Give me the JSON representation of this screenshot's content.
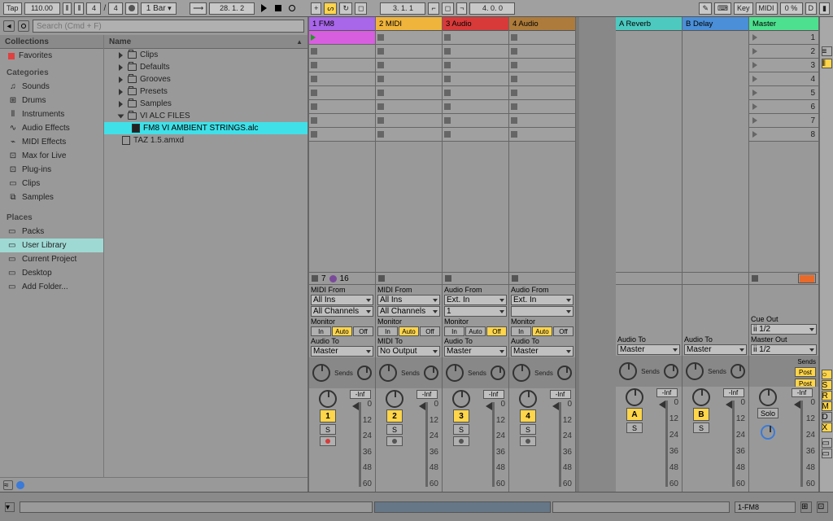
{
  "transport": {
    "tap": "Tap",
    "tempo": "110.00",
    "sig_num": "4",
    "sig_den": "4",
    "quantize": "1 Bar",
    "position": "28.  1.  2",
    "arrangement_pos": " 3.  1.  1",
    "loop_len": " 4.  0.  0",
    "key": "Key",
    "midi": "MIDI",
    "cpu": "0 %",
    "disk": "D"
  },
  "browser": {
    "search_placeholder": "Search (Cmd + F)",
    "collections_title": "Collections",
    "favorites": "Favorites",
    "categories_title": "Categories",
    "categories": [
      "Sounds",
      "Drums",
      "Instruments",
      "Audio Effects",
      "MIDI Effects",
      "Max for Live",
      "Plug-ins",
      "Clips",
      "Samples"
    ],
    "places_title": "Places",
    "places": [
      "Packs",
      "User Library",
      "Current Project",
      "Desktop",
      "Add Folder..."
    ],
    "name_header": "Name",
    "folders": [
      "Clips",
      "Defaults",
      "Grooves",
      "Presets",
      "Samples",
      "VI ALC FILES"
    ],
    "selected_file": "FM8 VI AMBIENT STRINGS.alc",
    "other_file": "TAZ 1.5.amxd"
  },
  "tracks": [
    {
      "name": "1 FM8",
      "cls": "fm8",
      "io_from": "MIDI From",
      "in1": "All Ins",
      "in2": "All Channels",
      "monitor": "Auto",
      "to_label": "Audio To",
      "out": "Master",
      "num": "1",
      "armed": true,
      "midi_count": "7",
      "midi_total": "16",
      "has_channel": true
    },
    {
      "name": "2 MIDI",
      "cls": "midi",
      "io_from": "MIDI From",
      "in1": "All Ins",
      "in2": "All Channels",
      "monitor": "Auto",
      "to_label": "MIDI To",
      "out": "No Output",
      "num": "2",
      "armed": false,
      "has_channel": true
    },
    {
      "name": "3 Audio",
      "cls": "audio3",
      "io_from": "Audio From",
      "in1": "Ext. In",
      "in2": "1",
      "monitor": "Off",
      "to_label": "Audio To",
      "out": "Master",
      "num": "3",
      "armed": false,
      "has_channel": true
    },
    {
      "name": "4 Audio",
      "cls": "audio4",
      "io_from": "Audio From",
      "in1": "Ext. In",
      "in2": "",
      "monitor": "Auto",
      "to_label": "Audio To",
      "out": "Master",
      "num": "4",
      "armed": false,
      "has_channel": true
    }
  ],
  "returns": [
    {
      "name": "A Reverb",
      "cls": "reverb",
      "to_label": "Audio To",
      "out": "Master",
      "num": "A"
    },
    {
      "name": "B Delay",
      "cls": "delay",
      "to_label": "Audio To",
      "out": "Master",
      "num": "B"
    }
  ],
  "master": {
    "name": "Master",
    "scenes": [
      "1",
      "2",
      "3",
      "4",
      "5",
      "6",
      "7",
      "8"
    ],
    "cue_out": "Cue Out",
    "cue_val": "ii 1/2",
    "master_out": "Master Out",
    "master_val": "ii 1/2",
    "solo": "Solo",
    "post": "Post",
    "sends": "Sends"
  },
  "mixer": {
    "sends": "Sends",
    "inf": "-Inf",
    "scale": [
      "0",
      "12",
      "24",
      "36",
      "48",
      "60"
    ],
    "monitor_labels": {
      "in": "In",
      "auto": "Auto",
      "off": "Off",
      "monitor": "Monitor"
    },
    "s": "S"
  },
  "status": {
    "clip": "1-FM8"
  }
}
